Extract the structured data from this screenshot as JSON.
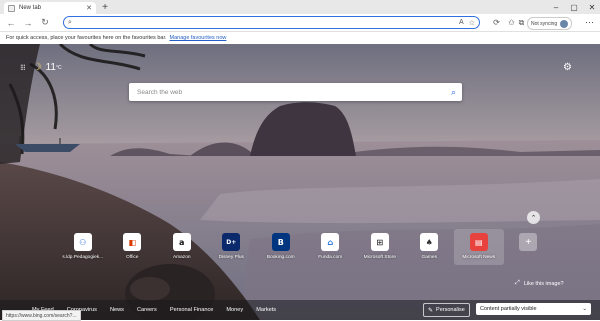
{
  "tab": {
    "title": "New tab",
    "close_icon": "close-icon"
  },
  "address": {
    "value": "",
    "placeholder": ""
  },
  "toolbar": {
    "profile_label": "Not syncing"
  },
  "favorites_bar": {
    "text": "For quick access, place your favourites here on the favourites bar.",
    "link": "Manage favourites now"
  },
  "weather": {
    "temp": "11",
    "unit": "°C"
  },
  "search": {
    "placeholder": "Search the web"
  },
  "quick_links": [
    {
      "label": "s.ldp.Pedagogiek...",
      "icon": "users-icon",
      "color": "#2f6fe0",
      "glyph": "⚇"
    },
    {
      "label": "Office",
      "icon": "office-icon",
      "color": "#d83b01",
      "glyph": "◧"
    },
    {
      "label": "Amazon",
      "icon": "amazon-icon",
      "color": "#111111",
      "glyph": "a"
    },
    {
      "label": "Disney Plus",
      "icon": "disney-icon",
      "color": "#0b2a6b",
      "glyph": "D+"
    },
    {
      "label": "Booking.com",
      "icon": "booking-icon",
      "color": "#003580",
      "glyph": "B"
    },
    {
      "label": "Funda.com",
      "icon": "funda-icon",
      "color": "#1d6fd6",
      "glyph": "⌂"
    },
    {
      "label": "Microsoft Store",
      "icon": "store-icon",
      "color": "#333333",
      "glyph": "⊞"
    },
    {
      "label": "Games",
      "icon": "games-icon",
      "color": "#333333",
      "glyph": "♠"
    },
    {
      "label": "Microsoft News",
      "icon": "news-icon",
      "color": "#e8423f",
      "glyph": "▤"
    }
  ],
  "like_image": {
    "label": "Like this image?"
  },
  "bottom_nav": [
    "My Feed",
    "Coronavirus",
    "News",
    "Careers",
    "Personal Finance",
    "Money",
    "Markets"
  ],
  "personalise": {
    "label": "Personalise"
  },
  "content_visibility": {
    "label": "Content partially visible"
  },
  "status_url": "https://www.bing.com/search?..."
}
